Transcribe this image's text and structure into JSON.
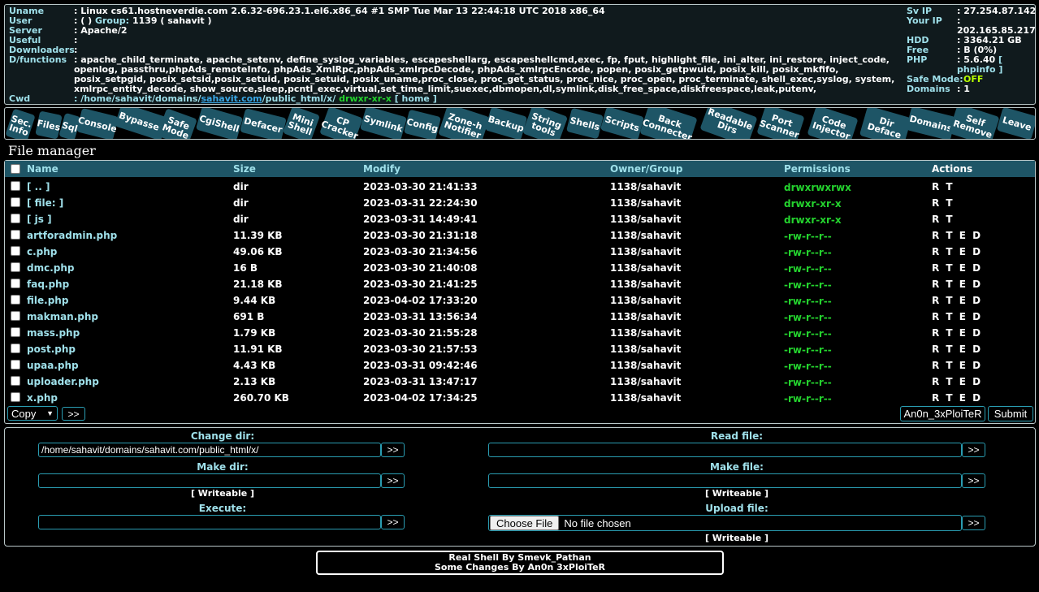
{
  "info": {
    "labels": {
      "uname": "Uname",
      "user": "User",
      "server": "Server",
      "useful": "Useful",
      "downloaders": "Downloaders",
      "dfunctions": "D/functions",
      "cwd": "Cwd"
    },
    "uname_value": ": Linux cs61.hostneverdie.com 2.6.32-696.23.1.el6.x86_64 #1 SMP Tue Mar 13 22:44:18 UTC 2018 x86_64",
    "user_prefix": ": ( )",
    "group_label": "Group:",
    "group_value": "1139 ( sahavit )",
    "server_value": ": Apache/2",
    "useful_value": ":",
    "downloaders_value": ":",
    "dfunctions_value": ": apache_child_terminate, apache_setenv, define_syslog_variables, escapeshellarg, escapeshellcmd,exec, fp, fput, highlight_file, ini_alter, ini_restore, inject_code, openlog, passthru,phpAds_remoteInfo, phpAds_XmlRpc,phpAds_xmlrpcDecode, phpAds_xmlrpcEncode, popen, posix_getpwuid, posix_kill, posix_mkfifo, posix_setpgid, posix_setsid,posix_setuid, posix_setuid, posix_uname,proc_close, proc_get_status, proc_nice, proc_open, proc_terminate, shell_exec,syslog, system, xmlrpc_entity_decode, show_source,sleep,pcntl_exec,virtual,set_time_limit,suexec,dbmopen,dl,symlink,disk_free_space,diskfreespace,leak,putenv,",
    "cwd_prefix": ": /home/sahavit/domains/",
    "cwd_domain": "sahavit.com",
    "cwd_suffix": "/public_html/x/",
    "cwd_perm": "drwxr-xr-x",
    "cwd_home": "[ home ]",
    "right": {
      "sv_ip_label": "Sv IP",
      "sv_ip": ": 27.254.87.142",
      "your_ip_label": "Your IP",
      "your_ip": ": 202.165.85.217",
      "hdd_label": "HDD",
      "hdd": ": 3364.21 GB",
      "free_label": "Free",
      "free": ": B (0%)",
      "php_label": "PHP",
      "php": ": 5.6.40",
      "phpinfo": "[ phpinfo ]",
      "safe_mode_label": "Safe Mode:",
      "safe_mode": "OFF",
      "domains_label": "Domains",
      "domains": ": 1"
    }
  },
  "tabs": [
    {
      "label": "Sec. Info",
      "key": "sec-info"
    },
    {
      "label": "Files",
      "key": "files"
    },
    {
      "label": "Sql",
      "key": "sql"
    },
    {
      "label": "Console",
      "key": "console"
    },
    {
      "label": "Bypasser",
      "key": "bypasser"
    },
    {
      "label": "Safe Mode",
      "key": "safe-mode"
    },
    {
      "label": "CgiShell",
      "key": "cgishell"
    },
    {
      "label": "Defacer",
      "key": "defacer"
    },
    {
      "label": "Mini Shell",
      "key": "mini-shell"
    },
    {
      "label": "CP Cracker",
      "key": "cp-cracker"
    },
    {
      "label": "Symlink",
      "key": "symlink"
    },
    {
      "label": "Config",
      "key": "config"
    },
    {
      "label": "Zone-h Notifier",
      "key": "zone-h-notifier"
    },
    {
      "label": "Backup",
      "key": "backup"
    },
    {
      "label": "String tools",
      "key": "string-tools"
    },
    {
      "label": "Shells",
      "key": "shells"
    },
    {
      "label": "Scripts",
      "key": "scripts"
    },
    {
      "label": "Back Connecter",
      "key": "back-connecter"
    },
    {
      "label": "Readable Dirs",
      "key": "readable-dirs"
    },
    {
      "label": "Port Scanner",
      "key": "port-scanner"
    },
    {
      "label": "Code Injector",
      "key": "code-injector"
    },
    {
      "label": "Dir Deface",
      "key": "dir-deface"
    },
    {
      "label": "Domains",
      "key": "domains"
    },
    {
      "label": "Self Remove",
      "key": "self-remove"
    },
    {
      "label": "Leave",
      "key": "leave"
    }
  ],
  "file_manager": {
    "title": "File manager",
    "columns": {
      "name": "Name",
      "size": "Size",
      "modify": "Modify",
      "owner": "Owner/Group",
      "perms": "Permissions",
      "actions": "Actions"
    },
    "rows": [
      {
        "name": "[ .. ]",
        "size": "dir",
        "modify": "2023-03-30 21:41:33",
        "owner": "1138/sahavit",
        "perms": "drwxrwxrwx",
        "actions": "R T"
      },
      {
        "name": "[ file: ]",
        "size": "dir",
        "modify": "2023-03-31 22:24:30",
        "owner": "1138/sahavit",
        "perms": "drwxr-xr-x",
        "actions": "R T"
      },
      {
        "name": "[ js ]",
        "size": "dir",
        "modify": "2023-03-31 14:49:41",
        "owner": "1138/sahavit",
        "perms": "drwxr-xr-x",
        "actions": "R T"
      },
      {
        "name": "artforadmin.php",
        "size": "11.39 KB",
        "modify": "2023-03-30 21:31:18",
        "owner": "1138/sahavit",
        "perms": "-rw-r--r--",
        "actions": "R T E D"
      },
      {
        "name": "c.php",
        "size": "49.06 KB",
        "modify": "2023-03-30 21:34:56",
        "owner": "1138/sahavit",
        "perms": "-rw-r--r--",
        "actions": "R T E D"
      },
      {
        "name": "dmc.php",
        "size": "16 B",
        "modify": "2023-03-30 21:40:08",
        "owner": "1138/sahavit",
        "perms": "-rw-r--r--",
        "actions": "R T E D"
      },
      {
        "name": "faq.php",
        "size": "21.18 KB",
        "modify": "2023-03-30 21:41:25",
        "owner": "1138/sahavit",
        "perms": "-rw-r--r--",
        "actions": "R T E D"
      },
      {
        "name": "file.php",
        "size": "9.44 KB",
        "modify": "2023-04-02 17:33:20",
        "owner": "1138/sahavit",
        "perms": "-rw-r--r--",
        "actions": "R T E D"
      },
      {
        "name": "makman.php",
        "size": "691 B",
        "modify": "2023-03-31 13:56:34",
        "owner": "1138/sahavit",
        "perms": "-rw-r--r--",
        "actions": "R T E D"
      },
      {
        "name": "mass.php",
        "size": "1.79 KB",
        "modify": "2023-03-30 21:55:28",
        "owner": "1138/sahavit",
        "perms": "-rw-r--r--",
        "actions": "R T E D"
      },
      {
        "name": "post.php",
        "size": "11.91 KB",
        "modify": "2023-03-30 21:57:53",
        "owner": "1138/sahavit",
        "perms": "-rw-r--r--",
        "actions": "R T E D"
      },
      {
        "name": "upaa.php",
        "size": "4.43 KB",
        "modify": "2023-03-31 09:42:46",
        "owner": "1138/sahavit",
        "perms": "-rw-r--r--",
        "actions": "R T E D"
      },
      {
        "name": "uploader.php",
        "size": "2.13 KB",
        "modify": "2023-03-31 13:47:17",
        "owner": "1138/sahavit",
        "perms": "-rw-r--r--",
        "actions": "R T E D"
      },
      {
        "name": "x.php",
        "size": "260.70 KB",
        "modify": "2023-04-02 17:34:25",
        "owner": "1138/sahavit",
        "perms": "-rw-r--r--",
        "actions": "R T E D"
      }
    ],
    "copy_select": "Copy",
    "go_button": ">>",
    "author_button": "An0n_3xPloiTeR",
    "submit_button": "Submit"
  },
  "tools": {
    "change_dir_label": "Change dir:",
    "change_dir_value": "/home/sahavit/domains/sahavit.com/public_html/x/",
    "read_file_label": "Read file:",
    "read_file_value": "",
    "make_dir_label": "Make dir:",
    "make_dir_value": "",
    "make_file_label": "Make file:",
    "make_file_value": "",
    "execute_label": "Execute:",
    "execute_value": "",
    "upload_label": "Upload file:",
    "choose_file": "Choose File",
    "no_file": "No file chosen",
    "writeable": "[ Writeable ]",
    "go": ">>"
  },
  "footer": {
    "line1": "Real Shell By Smevk_Pathan",
    "line2": "Some Changes By An0n 3xPloiTeR"
  },
  "colors": {
    "accent": "#1e5566",
    "label": "#9fe0ea",
    "perm_green": "#24d32e",
    "safe_off": "#b7ff00",
    "border": "#2a9db2"
  }
}
